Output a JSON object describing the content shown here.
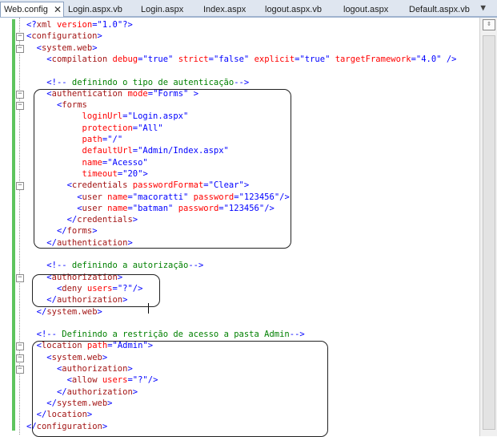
{
  "tabs": [
    {
      "label": "Web.config",
      "active": true
    },
    {
      "label": "Login.aspx.vb"
    },
    {
      "label": "Login.aspx"
    },
    {
      "label": "Index.aspx"
    },
    {
      "label": "logout.aspx.vb"
    },
    {
      "label": "logout.aspx"
    },
    {
      "label": "Default.aspx.vb"
    }
  ],
  "tab_close_glyph": "✕",
  "tab_dropdown_glyph": "▼",
  "split_glyph": "⇳",
  "code_lines": [
    "<?xml version=\"1.0\"?>",
    "<configuration>",
    "  <system.web>",
    "    <compilation debug=\"true\" strict=\"false\" explicit=\"true\" targetFramework=\"4.0\" />",
    "",
    "    <!-- definindo o tipo de autenticação-->",
    "    <authentication mode=\"Forms\" >",
    "      <forms",
    "           loginUrl=\"Login.aspx\"",
    "           protection=\"All\"",
    "           path=\"/\"",
    "           defaultUrl=\"Admin/Index.aspx\"",
    "           name=\"Acesso\"",
    "           timeout=\"20\">",
    "        <credentials passwordFormat=\"Clear\">",
    "          <user name=\"macoratti\" password=\"123456\"/>",
    "          <user name=\"batman\" password=\"123456\"/>",
    "        </credentials>",
    "      </forms>",
    "    </authentication>",
    "",
    "    <!-- definindo a autorização-->",
    "    <authorization>",
    "      <deny users=\"?\"/>",
    "    </authorization>",
    "  </system.web>",
    "",
    "  <!-- Definindo a restrição de acesso a pasta Admin-->",
    "  <location path=\"Admin\">",
    "    <system.web>",
    "      <authorization>",
    "        <allow users=\"?\"/>",
    "      </authorization>",
    "    </system.web>",
    "  </location>",
    "</configuration>"
  ],
  "colors": {
    "bracket": "#0000ff",
    "element": "#a31515",
    "attribute": "#ff0000",
    "comment": "#008000",
    "changed_bar": "#5ec45e"
  }
}
